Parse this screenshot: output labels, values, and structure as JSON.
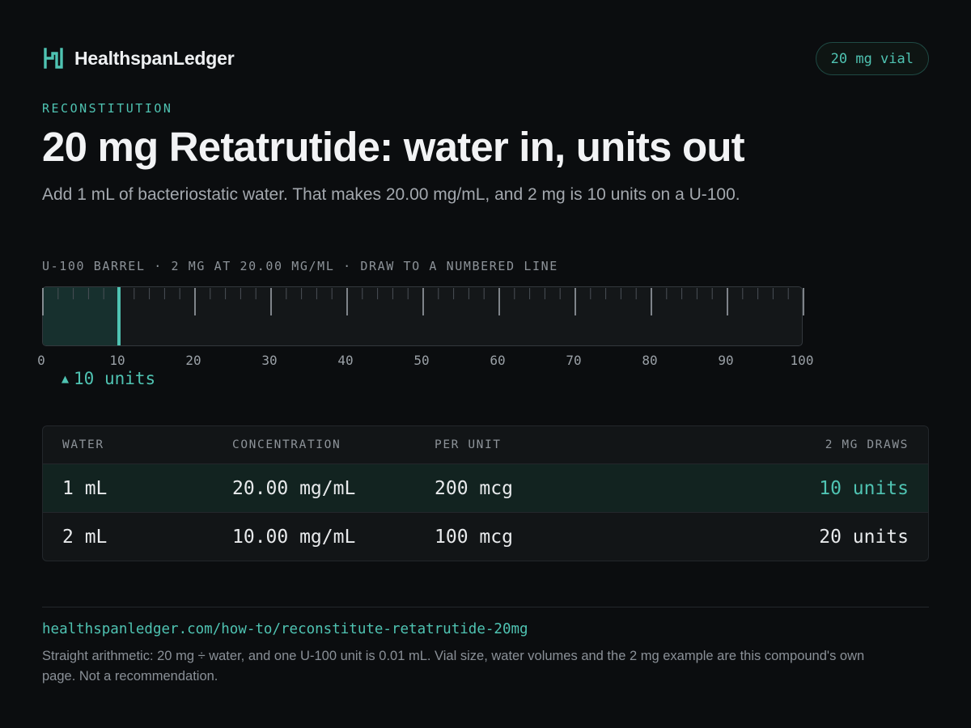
{
  "brand": {
    "name": "HealthspanLedger",
    "logo_icon": "hl-monogram-icon"
  },
  "badge": {
    "label": "20 mg vial"
  },
  "eyebrow": "RECONSTITUTION",
  "title": "20 mg Retatrutide:  water  in, units out",
  "subtitle": "Add 1 mL of bacteriostatic  water. That makes 20.00 mg/mL, and 2 mg is 10 units on a U-100.",
  "syringe": {
    "caption": "U-100 BARREL · 2 MG AT 20.00 MG/ML · DRAW TO A NUMBERED LINE",
    "max_units": 100,
    "fill_units": 10,
    "tick_labels": [
      "0",
      "10",
      "20",
      "30",
      "40",
      "50",
      "60",
      "70",
      "80",
      "90",
      "100"
    ],
    "marker_label": "10 units",
    "marker_icon": "triangle-up-icon"
  },
  "table": {
    "headers": [
      "WATER",
      "CONCENTRATION",
      "PER UNIT",
      "2 MG DRAWS"
    ],
    "rows": [
      [
        "1 mL",
        "20.00 mg/mL",
        "200 mcg",
        "10 units"
      ],
      [
        "2 mL",
        "10.00 mg/mL",
        "100 mcg",
        "20 units"
      ]
    ],
    "highlighted_row": 0
  },
  "footer": {
    "url": "healthspanledger.com/how-to/reconstitute-retatrutide-20mg",
    "note": "Straight arithmetic:  20 mg ÷ water,  and one U-100 unit is 0.01 mL. Vial size, water volumes and the 2 mg example are this compound's own page. Not a recommendation."
  },
  "colors": {
    "background": "#0b0d0f",
    "accent": "#4fc3b2",
    "fill": "#17302e",
    "tick": "#9aa0a6",
    "muted_text": "#8d9399"
  }
}
